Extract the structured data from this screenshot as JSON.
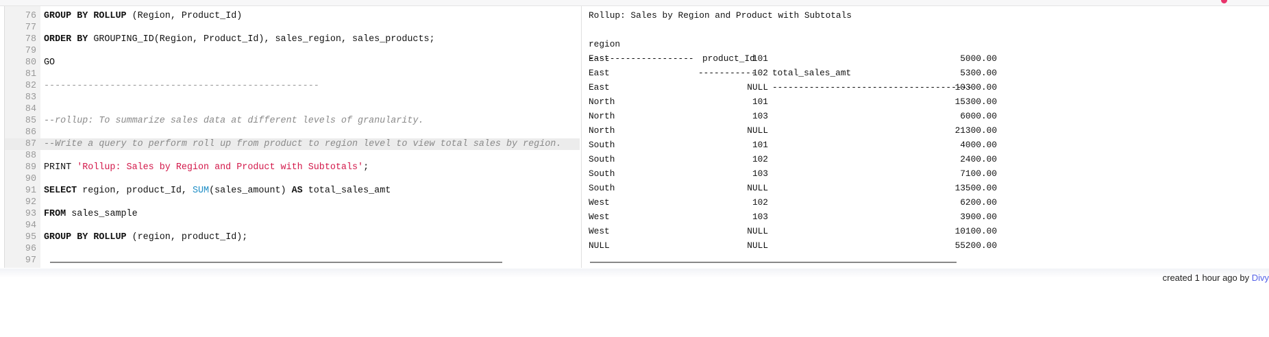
{
  "editor": {
    "lines": [
      {
        "n": "76",
        "parts": [
          [
            "kw",
            "GROUP BY ROLLUP"
          ],
          [
            "",
            "(Region, Product_Id)"
          ]
        ]
      },
      {
        "n": "77",
        "parts": []
      },
      {
        "n": "78",
        "parts": [
          [
            "kw",
            "ORDER BY"
          ],
          [
            "",
            "GROUPING_ID(Region, Product_Id), sales_region, sales_products;"
          ]
        ]
      },
      {
        "n": "79",
        "parts": []
      },
      {
        "n": "80",
        "parts": [
          [
            "",
            "GO"
          ]
        ]
      },
      {
        "n": "81",
        "parts": []
      },
      {
        "n": "82",
        "parts": [
          [
            "dash",
            "--------------------------------------------------"
          ]
        ]
      },
      {
        "n": "83",
        "parts": []
      },
      {
        "n": "84",
        "parts": []
      },
      {
        "n": "85",
        "parts": [
          [
            "cm",
            "--rollup: To summarize sales data at different levels of granularity."
          ]
        ]
      },
      {
        "n": "86",
        "parts": []
      },
      {
        "n": "87",
        "active": true,
        "parts": [
          [
            "cm",
            "--Write a query to perform roll up from product to region level to view total sales by region."
          ]
        ]
      },
      {
        "n": "88",
        "parts": []
      },
      {
        "n": "89",
        "parts": [
          [
            "",
            "PRINT "
          ],
          [
            "str",
            "'Rollup: Sales by Region and Product with Subtotals'"
          ],
          [
            "",
            ";"
          ]
        ]
      },
      {
        "n": "90",
        "parts": []
      },
      {
        "n": "91",
        "parts": [
          [
            "kw",
            "SELECT"
          ],
          [
            "",
            " region, product_Id, "
          ],
          [
            "fn",
            "SUM"
          ],
          [
            "",
            "(sales_amount) "
          ],
          [
            "kw",
            "AS"
          ],
          [
            "",
            " total_sales_amt"
          ]
        ]
      },
      {
        "n": "92",
        "parts": []
      },
      {
        "n": "93",
        "parts": [
          [
            "kw",
            "FROM"
          ],
          [
            "",
            " sales_sample"
          ]
        ]
      },
      {
        "n": "94",
        "parts": []
      },
      {
        "n": "95",
        "parts": [
          [
            "kw",
            "GROUP BY ROLLUP"
          ],
          [
            "",
            " (region, product_Id);"
          ]
        ]
      },
      {
        "n": "96",
        "parts": []
      },
      {
        "n": "97",
        "parts": []
      }
    ]
  },
  "output": {
    "message": "Rollup: Sales by Region and Product with Subtotals",
    "columns": [
      "region",
      "product_Id",
      "total_sales_amt"
    ],
    "separators": [
      "--------------------",
      "-----------",
      "--------------------------------------"
    ],
    "rows": [
      [
        "East",
        "101",
        "5000.00"
      ],
      [
        "East",
        "102",
        "5300.00"
      ],
      [
        "East",
        "NULL",
        "10300.00"
      ],
      [
        "North",
        "101",
        "15300.00"
      ],
      [
        "North",
        "103",
        "6000.00"
      ],
      [
        "North",
        "NULL",
        "21300.00"
      ],
      [
        "South",
        "101",
        "4000.00"
      ],
      [
        "South",
        "102",
        "2400.00"
      ],
      [
        "South",
        "103",
        "7100.00"
      ],
      [
        "South",
        "NULL",
        "13500.00"
      ],
      [
        "West",
        "102",
        "6200.00"
      ],
      [
        "West",
        "103",
        "3900.00"
      ],
      [
        "West",
        "NULL",
        "10100.00"
      ],
      [
        "NULL",
        "NULL",
        "55200.00"
      ]
    ]
  },
  "footer": {
    "created": "created 1 hour ago by ",
    "author": "Divy"
  }
}
